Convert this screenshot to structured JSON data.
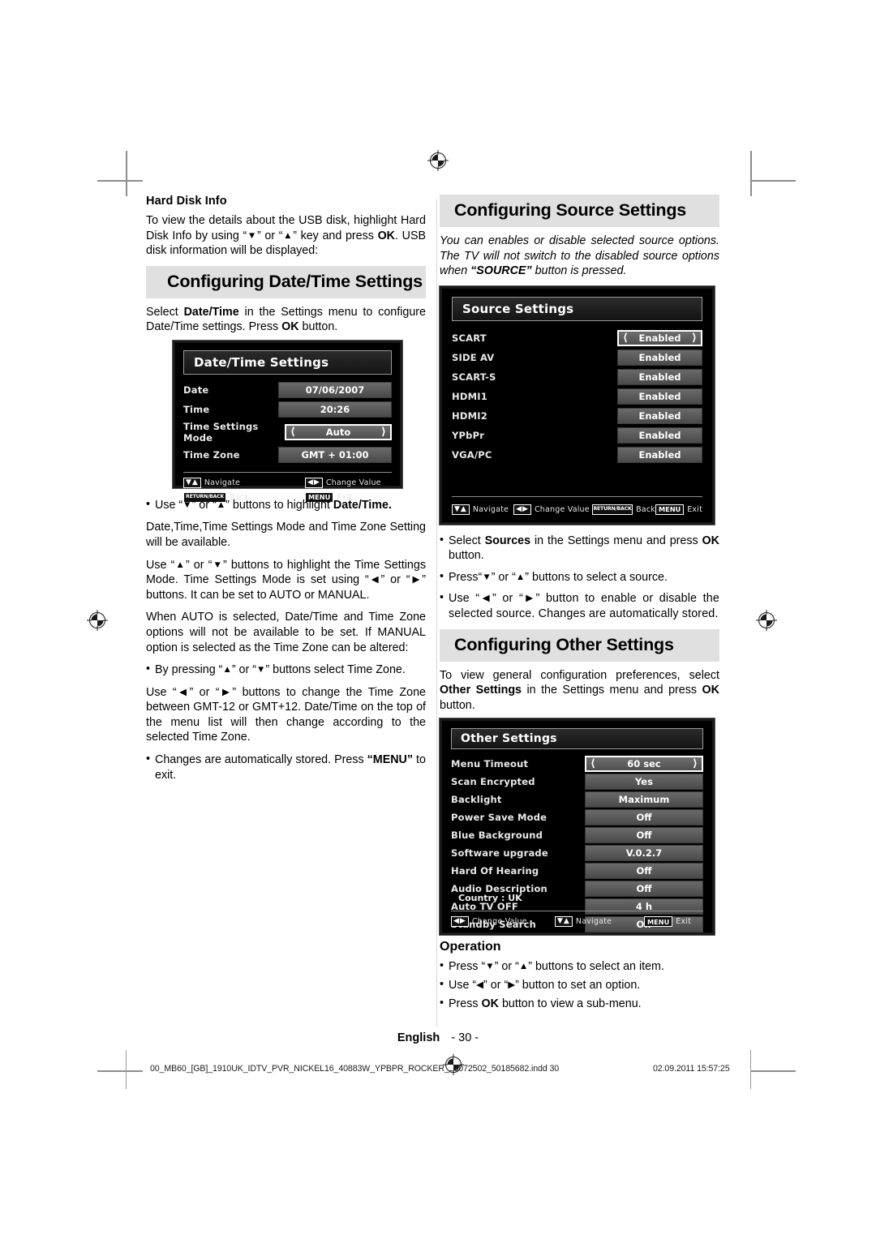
{
  "left_column": {
    "hard_disk_info": {
      "heading": "Hard Disk Info",
      "paragraph": "To view the details about the USB disk, highlight Hard Disk Info by using “▼” or “▲” key and press OK. USB disk information will be displayed:"
    },
    "date_time_banner": "Configuring Date/Time Settings",
    "date_time_intro": "Select Date/Time in the Settings menu to configure Date/Time settings. Press OK button.",
    "bullets_after_shot": [
      "Use “▼” or “▲” buttons to highlight Date/Time."
    ],
    "paragraphs": [
      "Date,Time,Time Settings Mode and Time Zone Setting will be available.",
      "Use “▲” or “▼” buttons to highlight the Time Settings Mode. Time Settings Mode is set using “◀” or “▶” buttons. It can be set to AUTO or MANUAL.",
      "When AUTO is selected, Date/Time and Time Zone options will not be available to be set. If MANUAL option is selected as the Time Zone can be altered:"
    ],
    "bullet_timezone": "By pressing “▲” or “▼” buttons select Time Zone.",
    "paragraph_timezone": "Use “◀” or “▶” buttons to change the Time Zone between GMT-12 or GMT+12. Date/Time on the top of the menu list will then change according to the selected Time Zone.",
    "bullet_stored": "Changes are automatically stored. Press “MENU” to exit."
  },
  "date_time_osd": {
    "title": "Date/Time Settings",
    "rows": [
      {
        "label": "Date",
        "value": "07/06/2007",
        "selected": false
      },
      {
        "label": "Time",
        "value": "20:26",
        "selected": false
      },
      {
        "label": "Time Settings Mode",
        "value": "Auto",
        "selected": true
      },
      {
        "label": "Time Zone",
        "value": "GMT + 01:00",
        "selected": false
      }
    ],
    "hints": [
      {
        "key": "▼▲",
        "type": "pair",
        "text": "Navigate"
      },
      {
        "key": "◀▶",
        "type": "pair",
        "text": "Change Value"
      },
      {
        "key": "RETURN/BACK",
        "type": "tiny",
        "text": "Back"
      },
      {
        "key": "MENU",
        "type": "menu",
        "text": "Exit"
      }
    ]
  },
  "right_column": {
    "source_banner": "Configuring Source Settings",
    "source_intro": "You can enables or disable selected source options. The TV will not switch to the disabled source options when “SOURCE” button is pressed.",
    "source_bullets": [
      "Select Sources in the Settings menu and press OK button.",
      "Press“▼” or “▲” buttons to select a source.",
      "Use “◀” or “▶” button to enable or disable the selected source. Changes are automatically stored."
    ],
    "other_banner": "Configuring Other Settings",
    "other_intro": "To view general configuration preferences, select Other Settings in the Settings menu and press OK button.",
    "operation_heading": "Operation",
    "operation_bullets": [
      "Press “▼” or “▲” buttons to select an item.",
      "Use “◀” or “▶” button to set an option.",
      "Press OK button to view a sub-menu."
    ]
  },
  "source_osd": {
    "title": "Source Settings",
    "rows": [
      {
        "label": "SCART",
        "value": "Enabled",
        "selected": true
      },
      {
        "label": "SIDE AV",
        "value": "Enabled",
        "selected": false
      },
      {
        "label": "SCART-S",
        "value": "Enabled",
        "selected": false
      },
      {
        "label": "HDMI1",
        "value": "Enabled",
        "selected": false
      },
      {
        "label": "HDMI2",
        "value": "Enabled",
        "selected": false
      },
      {
        "label": "YPbPr",
        "value": "Enabled",
        "selected": false
      },
      {
        "label": "VGA/PC",
        "value": "Enabled",
        "selected": false
      }
    ],
    "hints": [
      {
        "key": "▼▲",
        "type": "pair",
        "text": "Navigate"
      },
      {
        "key": "◀▶",
        "type": "pair",
        "text": "Change Value"
      },
      {
        "key": "RETURN/BACK",
        "type": "tiny",
        "text": "Back"
      },
      {
        "key": "MENU",
        "type": "menu",
        "text": "Exit"
      }
    ]
  },
  "other_osd": {
    "title": "Other Settings",
    "rows": [
      {
        "label": "Menu Timeout",
        "value": "60 sec",
        "selected": true
      },
      {
        "label": "Scan Encrypted",
        "value": "Yes",
        "selected": false
      },
      {
        "label": "Backlight",
        "value": "Maximum",
        "selected": false
      },
      {
        "label": "Power Save Mode",
        "value": "Off",
        "selected": false
      },
      {
        "label": "Blue Background",
        "value": "Off",
        "selected": false
      },
      {
        "label": "Software upgrade",
        "value": "V.0.2.7",
        "selected": false
      },
      {
        "label": "Hard Of Hearing",
        "value": "Off",
        "selected": false
      },
      {
        "label": "Audio Description",
        "value": "Off",
        "selected": false
      },
      {
        "label": "Auto TV OFF",
        "value": "4 h",
        "selected": false
      },
      {
        "label": "Standby Search",
        "value": "Off",
        "selected": false
      }
    ],
    "country": "Country : UK",
    "hints": [
      {
        "key": "◀▶",
        "type": "pair",
        "text": "Change Value"
      },
      {
        "key": "▼▲",
        "type": "pair",
        "text": "Navigate"
      },
      {
        "key": "MENU",
        "type": "menu",
        "text": "Exit"
      }
    ]
  },
  "footer": {
    "language": "English",
    "page_number": "- 30 -",
    "production_file": "00_MB60_[GB]_1910UK_IDTV_PVR_NICKEL16_40883W_YPBPR_ROCKER_10072502_50185682.indd   30",
    "production_timestamp": "02.09.2011   15:57:25"
  }
}
